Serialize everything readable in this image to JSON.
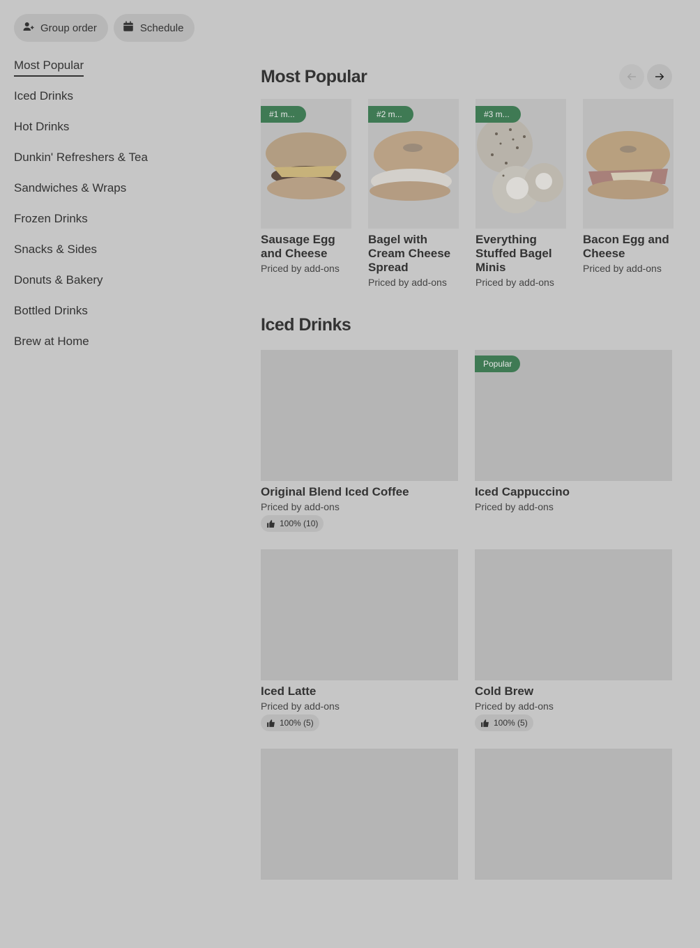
{
  "actions": {
    "group_order": "Group order",
    "schedule": "Schedule"
  },
  "sidebar": {
    "items": [
      {
        "label": "Most Popular",
        "active": true
      },
      {
        "label": "Iced Drinks"
      },
      {
        "label": "Hot Drinks"
      },
      {
        "label": "Dunkin' Refreshers & Tea"
      },
      {
        "label": "Sandwiches & Wraps"
      },
      {
        "label": "Frozen Drinks"
      },
      {
        "label": "Snacks & Sides"
      },
      {
        "label": "Donuts & Bakery"
      },
      {
        "label": "Bottled Drinks"
      },
      {
        "label": "Brew at Home"
      }
    ]
  },
  "most_popular": {
    "title": "Most Popular",
    "items": [
      {
        "badge": "#1 m...",
        "name": "Sausage Egg and Cheese",
        "price": "Priced by add-ons",
        "image": "sausage-egg-cheese-sandwich"
      },
      {
        "badge": "#2 m...",
        "name": "Bagel with Cream Cheese Spread",
        "price": "Priced by add-ons",
        "image": "bagel-cream-cheese"
      },
      {
        "badge": "#3 m...",
        "name": "Everything Stuffed Bagel Minis",
        "price": "Priced by add-ons",
        "image": "stuffed-bagel-minis"
      },
      {
        "name": "Bacon Egg and Cheese",
        "price": "Priced by add-ons",
        "image": "bacon-egg-cheese-bagel"
      }
    ]
  },
  "iced_drinks": {
    "title": "Iced Drinks",
    "items": [
      {
        "name": "Original Blend Iced Coffee",
        "price": "Priced by add-ons",
        "rating": "100% (10)"
      },
      {
        "name": "Iced Cappuccino",
        "price": "Priced by add-ons",
        "badge": "Popular"
      },
      {
        "name": "Iced Latte",
        "price": "Priced by add-ons",
        "rating": "100% (5)"
      },
      {
        "name": "Cold Brew",
        "price": "Priced by add-ons",
        "rating": "100% (5)"
      }
    ]
  },
  "colors": {
    "background": "#c6c6c6",
    "badge_green": "#3f7a54",
    "pill": "#b7b7b7"
  }
}
